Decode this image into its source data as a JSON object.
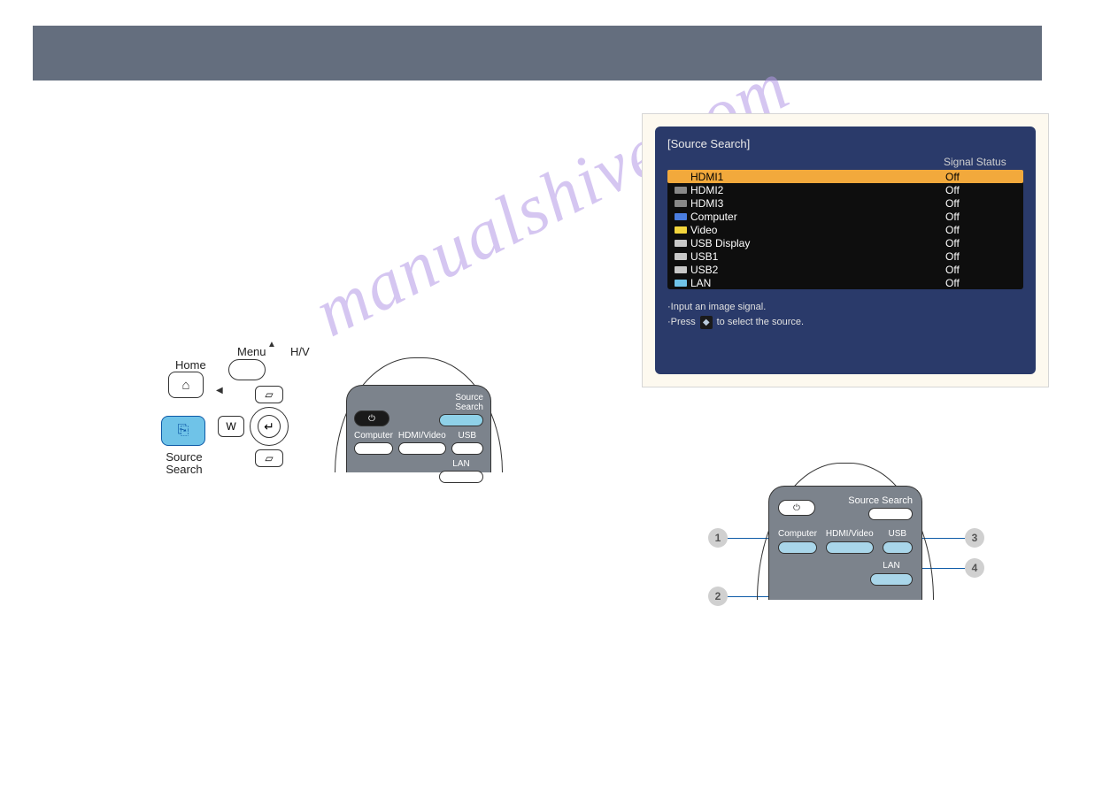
{
  "header": {
    "title": ""
  },
  "watermark": "manualshive.com",
  "ill": {
    "home": "Home",
    "source_search": "Source\nSearch",
    "menu": "Menu",
    "hv": "H/V",
    "w": "W",
    "keystone_up": "▱",
    "keystone_down": "▱"
  },
  "remote1": {
    "source_search": "Source Search",
    "computer": "Computer",
    "hdmi_video": "HDMI/Video",
    "usb": "USB",
    "lan": "LAN"
  },
  "osd": {
    "title": "[Source Search]",
    "header_status": "Signal Status",
    "rows": [
      {
        "name": "HDMI1",
        "status": "Off",
        "selected": true,
        "iconColor": "#f2a93c"
      },
      {
        "name": "HDMI2",
        "status": "Off",
        "selected": false,
        "iconColor": "#888"
      },
      {
        "name": "HDMI3",
        "status": "Off",
        "selected": false,
        "iconColor": "#888"
      },
      {
        "name": "Computer",
        "status": "Off",
        "selected": false,
        "iconColor": "#4a7de0"
      },
      {
        "name": "Video",
        "status": "Off",
        "selected": false,
        "iconColor": "#f2d53c"
      },
      {
        "name": "USB Display",
        "status": "Off",
        "selected": false,
        "iconColor": "#c8c8c8"
      },
      {
        "name": "USB1",
        "status": "Off",
        "selected": false,
        "iconColor": "#c8c8c8"
      },
      {
        "name": "USB2",
        "status": "Off",
        "selected": false,
        "iconColor": "#c8c8c8"
      },
      {
        "name": "LAN",
        "status": "Off",
        "selected": false,
        "iconColor": "#6fc3e8"
      }
    ],
    "hint1": "·Input an image signal.",
    "hint2_pre": "·Press",
    "hint2_key": "◆",
    "hint2_post": "to select the source."
  },
  "remote2": {
    "source_search": "Source Search",
    "computer": "Computer",
    "hdmi_video": "HDMI/Video",
    "usb": "USB",
    "lan": "LAN",
    "callouts": {
      "c1": "1",
      "c2": "2",
      "c3": "3",
      "c4": "4"
    }
  }
}
